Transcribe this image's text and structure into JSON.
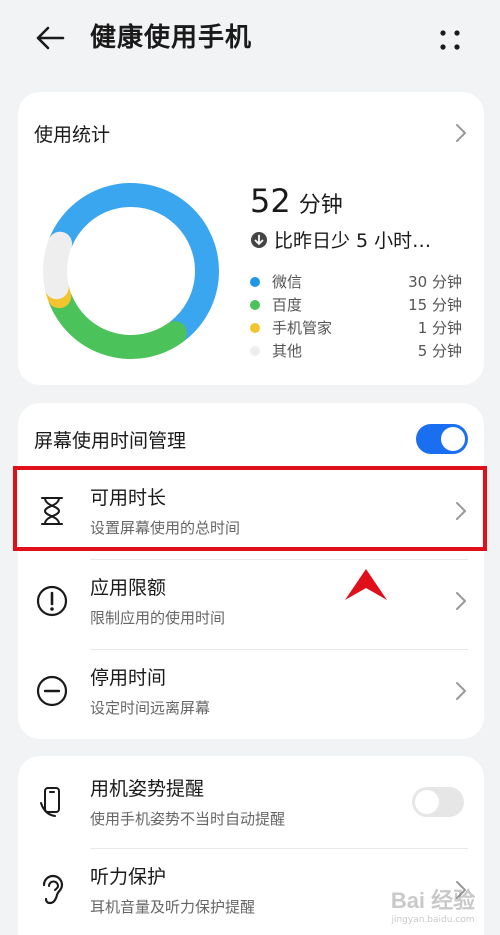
{
  "app_bar": {
    "title": "健康使用手机",
    "back_icon": "back-arrow-icon",
    "more_icon": "more-dots-icon"
  },
  "usage_stats": {
    "title": "使用统计",
    "total_value": "52",
    "total_unit": "分钟",
    "compare_text": "比昨日少 5 小时…",
    "compare_icon": "down-arrow-circle-icon",
    "legend": [
      {
        "name": "微信",
        "value": "30 分钟",
        "color": "#1f97e6"
      },
      {
        "name": "百度",
        "value": "15 分钟",
        "color": "#4cc25a"
      },
      {
        "name": "手机管家",
        "value": "1 分钟",
        "color": "#f2c530"
      },
      {
        "name": "其他",
        "value": "5 分钟",
        "color": "#eeeeee"
      }
    ]
  },
  "chart_data": {
    "type": "pie",
    "categories": [
      "微信",
      "百度",
      "手机管家",
      "其他"
    ],
    "values": [
      30,
      15,
      1,
      5
    ],
    "colors": [
      "#3aa6ef",
      "#4cc25a",
      "#f2c530",
      "#eeeeee"
    ]
  },
  "screen_time": {
    "title": "屏幕使用时间管理",
    "enabled": true,
    "items": [
      {
        "label": "可用时长",
        "sub": "设置屏幕使用的总时间",
        "icon": "hourglass-icon"
      },
      {
        "label": "应用限额",
        "sub": "限制应用的使用时间",
        "icon": "exclamation-circle-icon"
      },
      {
        "label": "停用时间",
        "sub": "设定时间远离屏幕",
        "icon": "minus-circle-icon"
      }
    ]
  },
  "extras": {
    "items": [
      {
        "label": "用机姿势提醒",
        "sub": "使用手机姿势不当时自动提醒",
        "icon": "phone-posture-icon",
        "enabled": false
      },
      {
        "label": "听力保护",
        "sub": "耳机音量及听力保护提醒",
        "icon": "ear-icon"
      }
    ]
  },
  "annotation": {
    "highlight_color": "#e0101b"
  },
  "watermark": {
    "brand": "Bai 经验",
    "url": "jingyan.baidu.com"
  }
}
